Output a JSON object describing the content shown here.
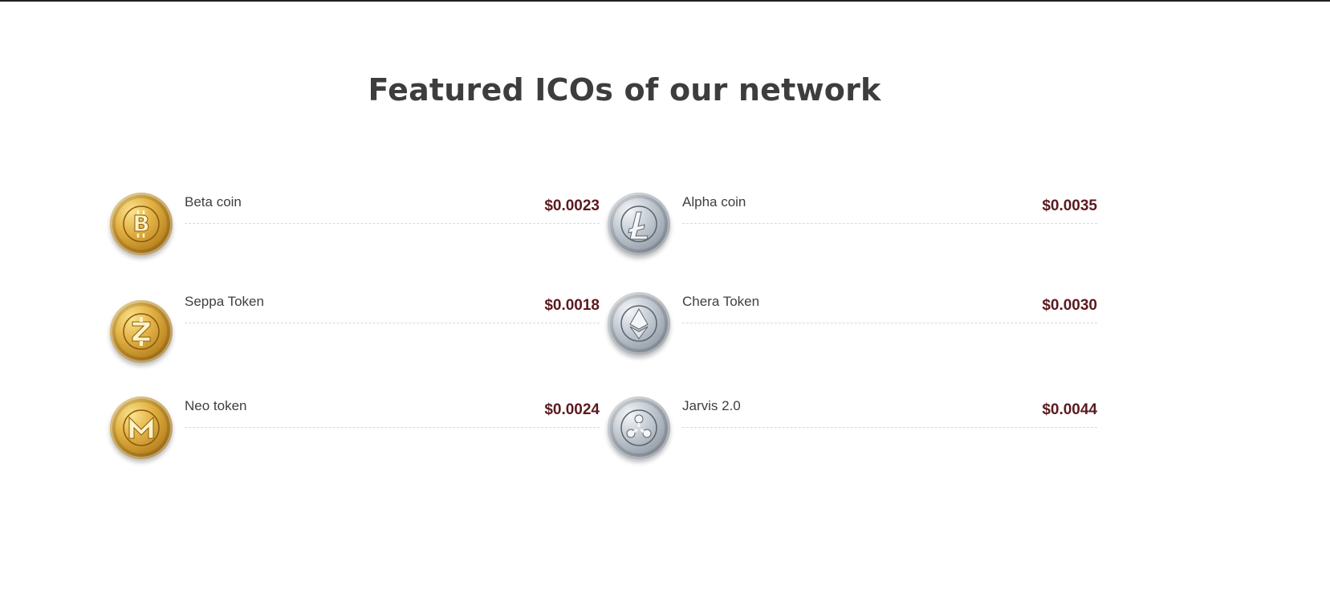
{
  "section": {
    "title": "Featured ICOs of our network"
  },
  "icos": [
    {
      "name": "Beta coin",
      "price": "$0.0023",
      "icon": "bitcoin-icon",
      "finish": "gold"
    },
    {
      "name": "Alpha coin",
      "price": "$0.0035",
      "icon": "litecoin-icon",
      "finish": "silver"
    },
    {
      "name": "Seppa Token",
      "price": "$0.0018",
      "icon": "zcash-icon",
      "finish": "gold"
    },
    {
      "name": "Chera Token",
      "price": "$0.0030",
      "icon": "ethereum-icon",
      "finish": "silver"
    },
    {
      "name": "Neo token",
      "price": "$0.0024",
      "icon": "monero-icon",
      "finish": "gold"
    },
    {
      "name": "Jarvis 2.0",
      "price": "$0.0044",
      "icon": "ripple-icon",
      "finish": "silver"
    }
  ],
  "colors": {
    "price": "#5c1a1f",
    "title": "#3d3d3d",
    "gold": "#d4a13a",
    "silver": "#aab2bc"
  }
}
